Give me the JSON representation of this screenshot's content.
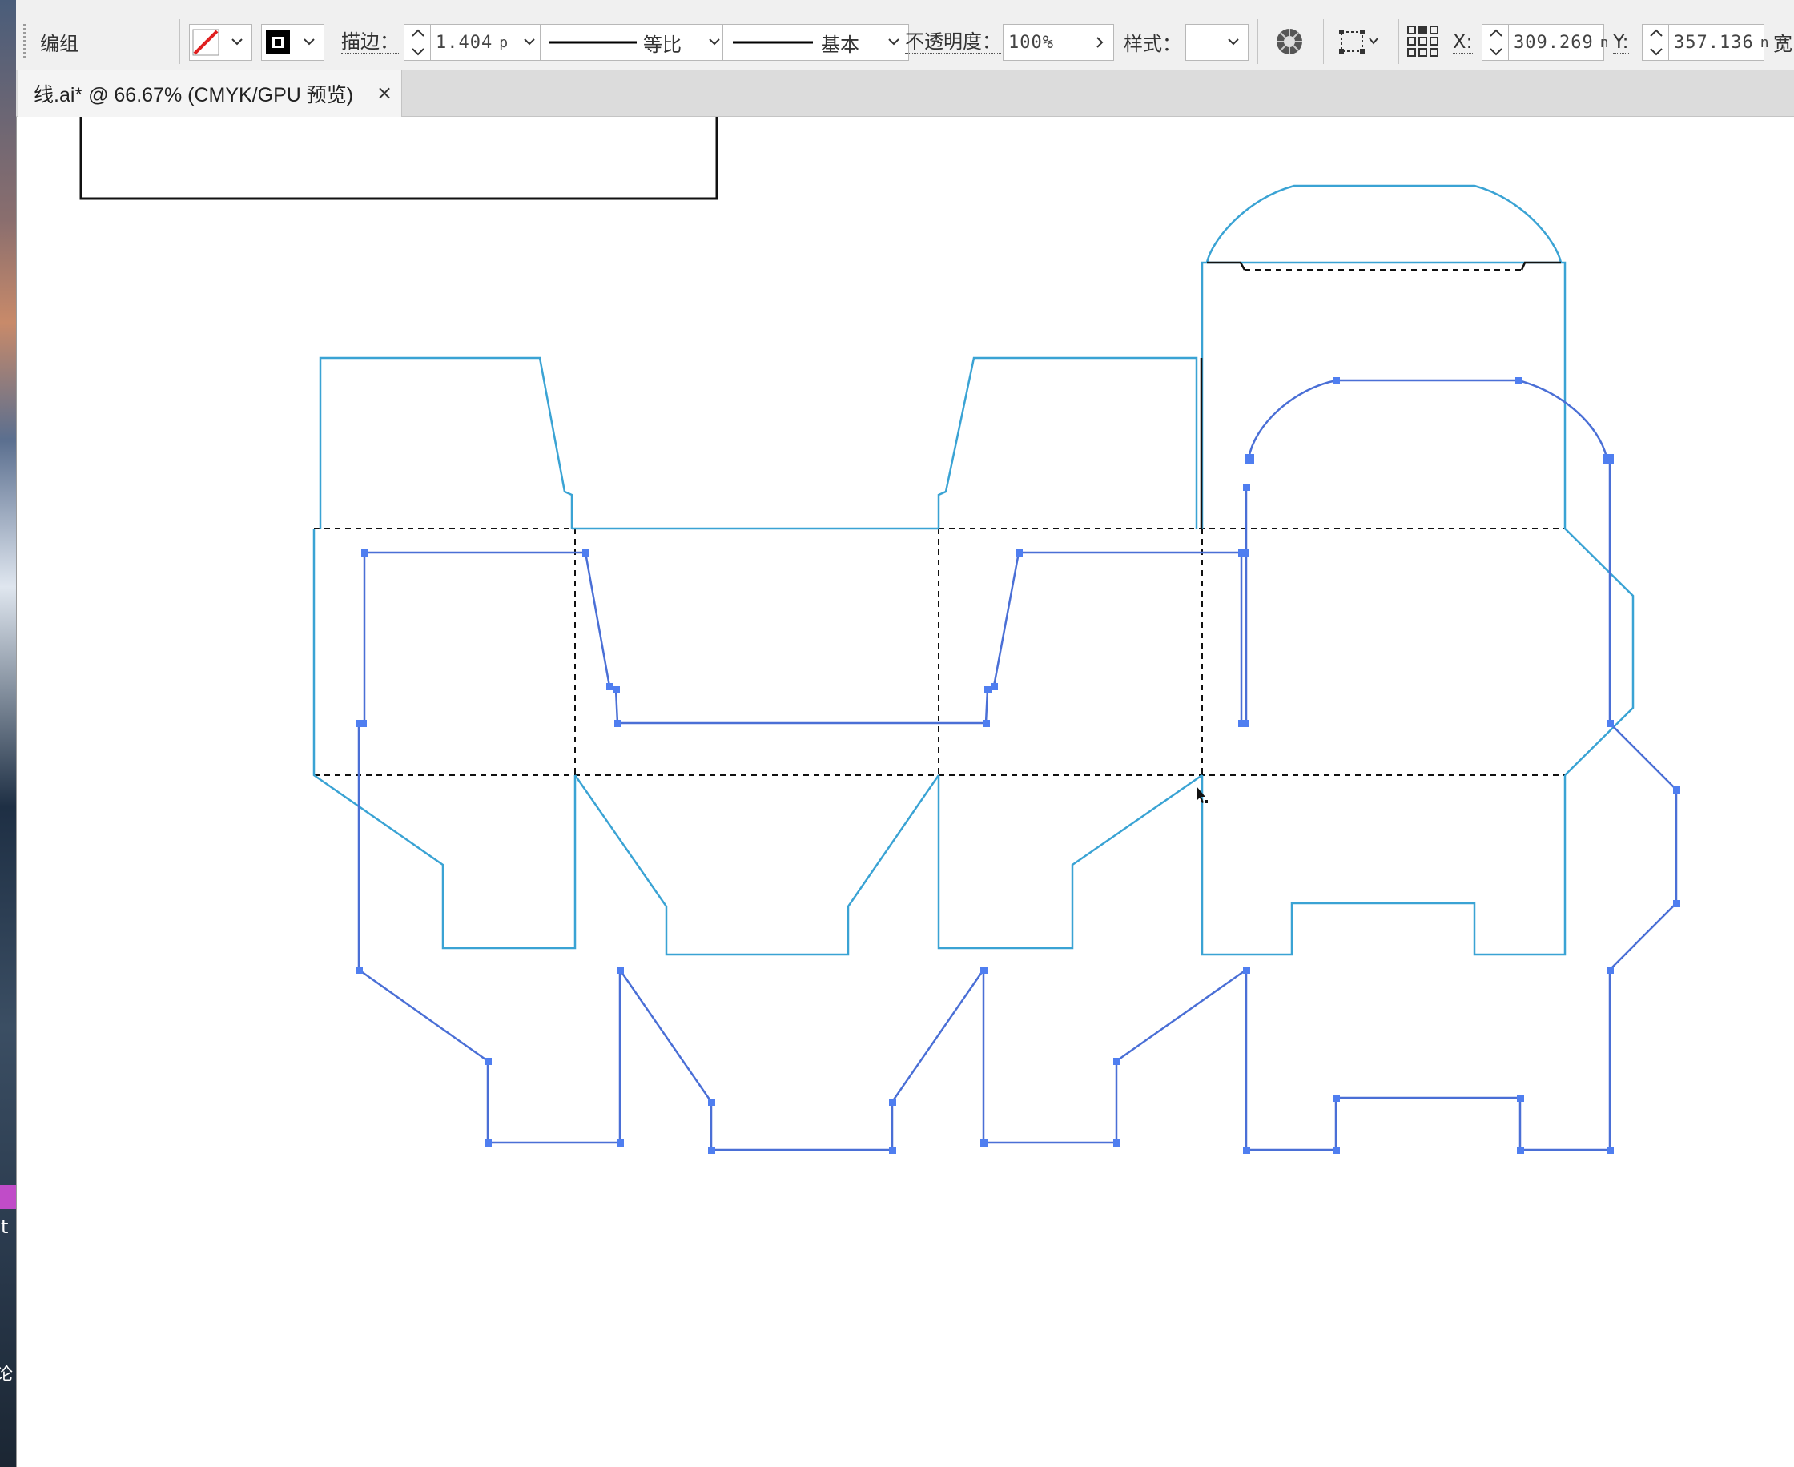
{
  "control_bar": {
    "selection_type": "编组",
    "stroke_label": "描边：",
    "stroke_value": "1.404",
    "stroke_unit_fragment": "p",
    "profile_label": "等比",
    "brush_label": "基本",
    "opacity_label": "不透明度：",
    "opacity_value": "100%",
    "style_label": "样式：",
    "x_label": "X:",
    "x_value": "309.269",
    "x_unit_fragment": "n",
    "y_label": "Y:",
    "y_value": "357.136",
    "y_unit_fragment": "n",
    "width_label_fragment": "宽",
    "fill_color": "none",
    "stroke_color": "#000000",
    "icons": [
      "fill-none-icon",
      "stroke-swatch-icon",
      "recolor-icon",
      "transform-icon",
      "align-grid-icon",
      "spinner-icon",
      "chevron-down-icon"
    ]
  },
  "document_tab": {
    "title": "线.ai* @ 66.67% (CMYK/GPU 预览)",
    "close_glyph": "×"
  },
  "artwork": {
    "cut_line_color": "#3aa3d4",
    "selected_path_color": "#4a6fd6",
    "anchor_color": "#4f7ef0",
    "fold_line_color": "#000000",
    "fold_line_style": "dashed"
  },
  "desktop_fragments": {
    "left_edge_text_1": "t",
    "left_edge_text_2": "论"
  }
}
